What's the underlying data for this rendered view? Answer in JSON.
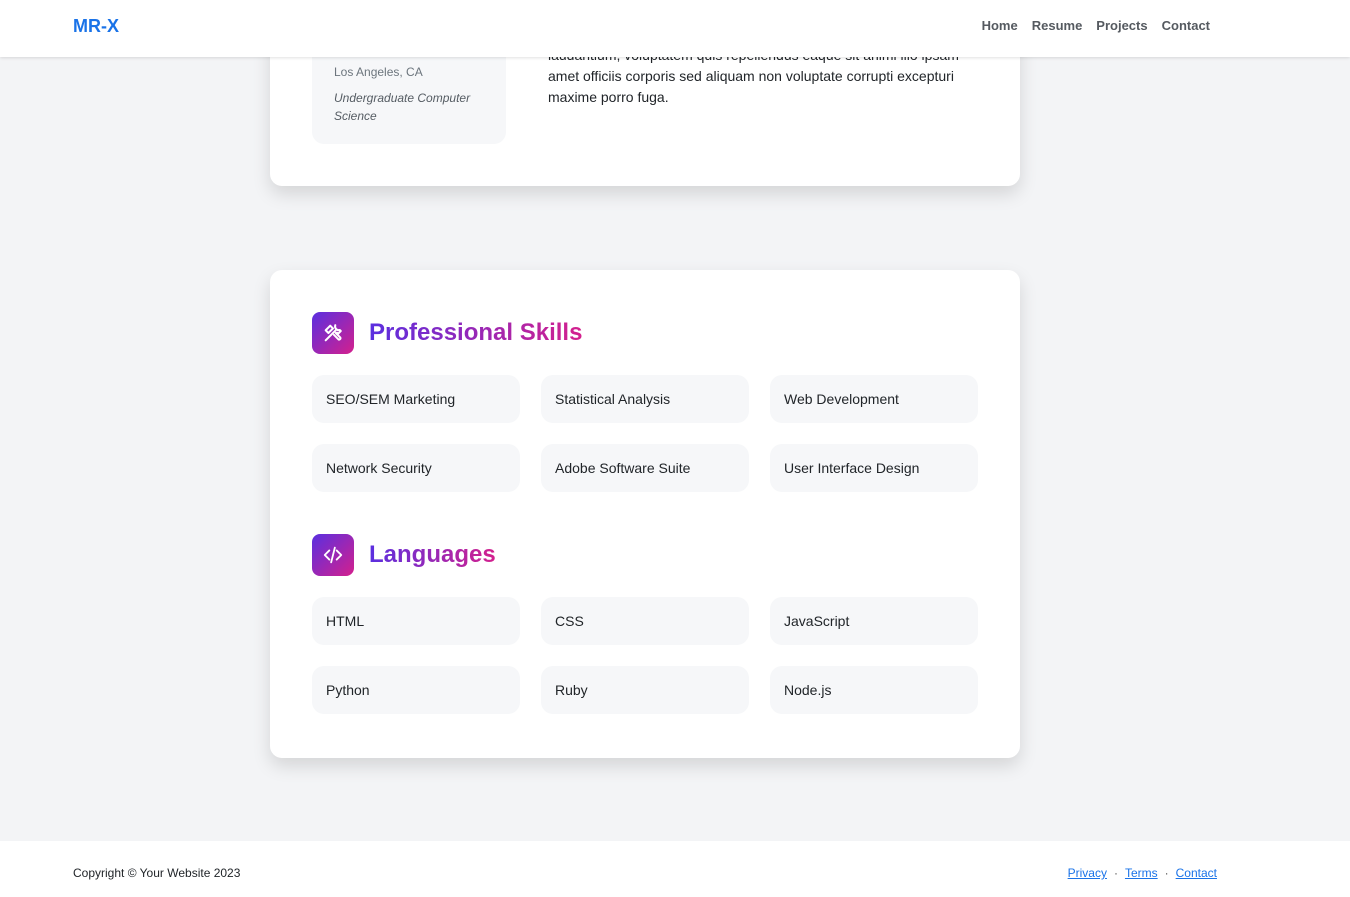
{
  "nav": {
    "brand": "MR-X",
    "links": [
      "Home",
      "Resume",
      "Projects",
      "Contact"
    ]
  },
  "education": {
    "location": "Los Angeles, CA",
    "degree": "Undergraduate Computer Science",
    "description": "laudantium, voluptatem quis repellendus eaque sit animi illo ipsam amet officiis corporis sed aliquam non voluptate corrupti excepturi maxime porro fuga."
  },
  "skills": {
    "title": "Professional Skills",
    "icon": "tools-icon",
    "items": [
      "SEO/SEM Marketing",
      "Statistical Analysis",
      "Web Development",
      "Network Security",
      "Adobe Software Suite",
      "User Interface Design"
    ]
  },
  "languages": {
    "title": "Languages",
    "icon": "code-icon",
    "items": [
      "HTML",
      "CSS",
      "JavaScript",
      "Python",
      "Ruby",
      "Node.js"
    ]
  },
  "footer": {
    "copyright": "Copyright © Your Website 2023",
    "links": [
      "Privacy",
      "Terms",
      "Contact"
    ],
    "separator": "·"
  },
  "colors": {
    "brand": "#1a73e8",
    "gradient_start": "#5a2fe0",
    "gradient_end": "#d4208d"
  }
}
